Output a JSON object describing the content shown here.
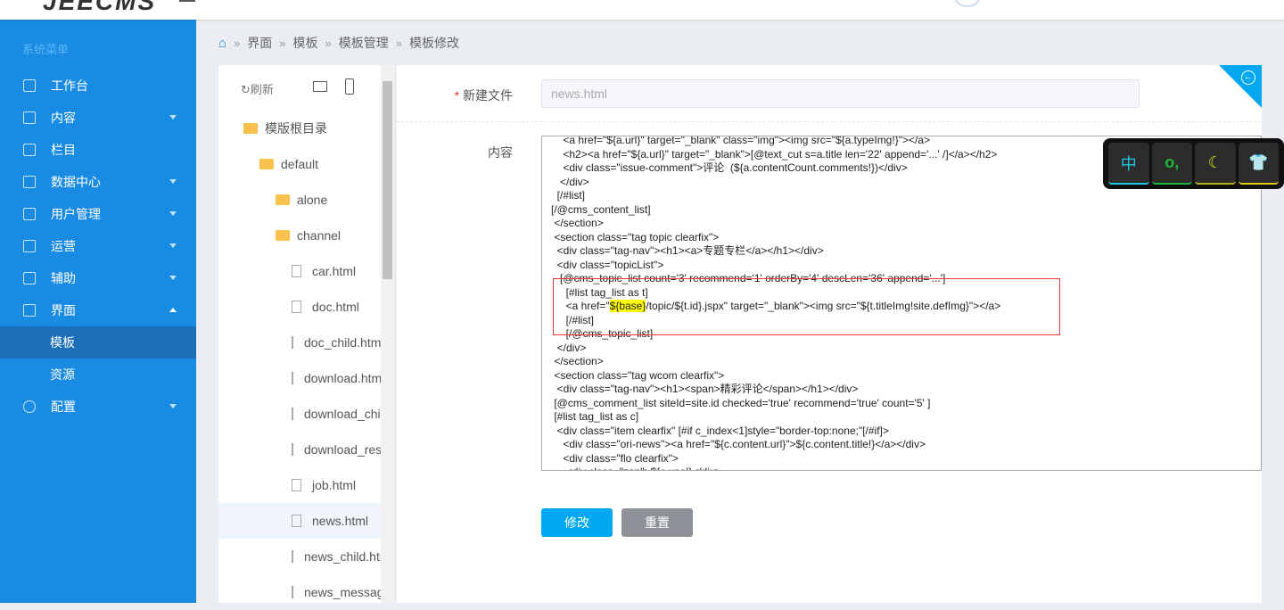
{
  "header": {
    "logo": "JEECMS"
  },
  "sidebar": {
    "title": "系统菜单",
    "items": [
      {
        "label": "工作台",
        "arrow": false
      },
      {
        "label": "内容",
        "arrow": true
      },
      {
        "label": "栏目",
        "arrow": false
      },
      {
        "label": "数据中心",
        "arrow": true
      },
      {
        "label": "用户管理",
        "arrow": true
      },
      {
        "label": "运营",
        "arrow": true
      },
      {
        "label": "辅助",
        "arrow": true
      },
      {
        "label": "界面",
        "arrow": true
      }
    ],
    "sub": [
      {
        "label": "模板",
        "active": true
      },
      {
        "label": "资源",
        "active": false
      }
    ],
    "last": {
      "label": "配置"
    }
  },
  "breadcrumb": [
    "界面",
    "模板",
    "模板管理",
    "模板修改"
  ],
  "tree": {
    "refresh": "刷新",
    "root": "模版根目录",
    "nodes": [
      "default",
      "alone",
      "channel",
      "car.html",
      "doc.html",
      "doc_child.html",
      "download.html",
      "download_child.html",
      "download_result.html",
      "job.html",
      "news.html",
      "news_child.html",
      "news_message.html"
    ],
    "selected": "news.html"
  },
  "form": {
    "file_label": "新建文件",
    "file_value": "news.html",
    "content_label": "内容",
    "submit": "修改",
    "reset": "重置"
  },
  "code": {
    "before": "    <a href=\"${a.url}\" target=\"_blank\" class=\"img\"><img src=\"${a.typeImg!}\"></a>\n    <h2><a href=\"${a.url}\" target=\"_blank\">[@text_cut s=a.title len='22' append='...' /]</a></h2>\n    <div class=\"issue-comment\">评论  (${a.contentCount.comments!})</div>\n   </div>\n  [/#list]\n[/@cms_content_list]\n </section>\n <section class=\"tag topic clearfix\">\n  <div class=\"tag-nav\"><h1><a>专题专栏</a></h1></div>\n  <div class=\"topicList\">\n   [@cms_topic_list count='3' recommend='1' orderBy='4' descLen='36' append='...']\n     [#list tag_list as t]\n     <a href=\"",
    "highlight": "${base}",
    "after": "/topic/${t.id}.jspx\" target=\"_blank\"><img src=\"${t.titleImg!site.defImg}\"></a>\n     [/#list]\n     [/@cms_topic_list]\n  </div>\n </section>\n <section class=\"tag wcom clearfix\">\n  <div class=\"tag-nav\"><h1><span>精彩评论</span></h1></div>\n [@cms_comment_list siteId=site.id checked='true' recommend='true' count='5' ]\n [#list tag_list as c]\n  <div class=\"item clearfix\" [#if c_index<1]style=\"border-top:none;\"[/#if]>\n    <div class=\"ori-news\"><a href=\"${c.content.url}\">${c.content.title!}</a></div>\n    <div class=\"flo clearfix\">\n     <div class=\"zan\">${c.ups!}</div>"
  },
  "ime": {
    "keys": [
      "中",
      "o,",
      "moon-icon",
      "shirt-icon"
    ]
  },
  "colors": {
    "sidebar": "#1a8be3",
    "active": "#1a6fb8",
    "primary": "#00a8f3",
    "reset": "#8e9197"
  }
}
